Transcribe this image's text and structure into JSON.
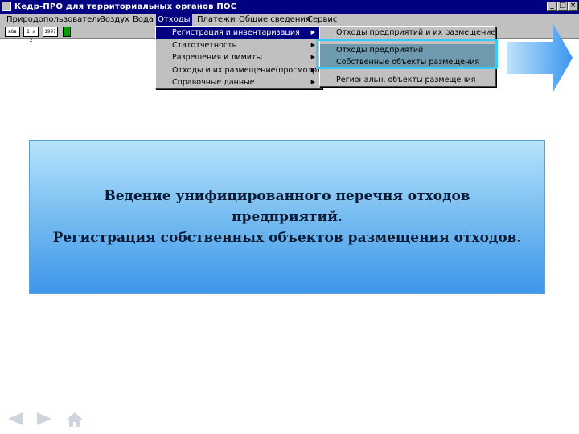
{
  "window": {
    "title": "Кедр-ПРО для территориальных органов ПОС",
    "buttons": [
      "_",
      "□",
      "×"
    ]
  },
  "menubar": {
    "items": [
      {
        "label": "Природопользователи",
        "active": false
      },
      {
        "label": "Воздух",
        "active": false
      },
      {
        "label": "Вода",
        "active": false
      },
      {
        "label": "Отходы",
        "active": true
      },
      {
        "label": "Платежи",
        "active": false
      },
      {
        "label": "Общие сведения",
        "active": false
      },
      {
        "label": "Сервис",
        "active": false
      }
    ]
  },
  "toolbar": {
    "buttons": [
      "абв",
      "1 x 2",
      "1997"
    ]
  },
  "menu_waste": {
    "items": [
      {
        "label": "Регистрация и инвентаризация",
        "submenu": true,
        "highlighted": true
      },
      {
        "label": "Статотчетность",
        "submenu": true
      },
      {
        "label": "Разрешения и лимиты",
        "submenu": true
      },
      {
        "label": "Отходы и их размещение(просмотр)",
        "submenu": true
      },
      {
        "label": "Справочные данные",
        "submenu": true
      }
    ]
  },
  "submenu_registration": {
    "items": [
      {
        "label": "Отходы предприятий и их размещение",
        "highlighted": false
      },
      {
        "label": "Отходы предприятий",
        "highlighted": true
      },
      {
        "label": "Собственные объекты размещения",
        "highlighted": true
      },
      {
        "label": "Региональн. объекты размещения",
        "highlighted": false
      }
    ]
  },
  "info_panel": {
    "lines": [
      "Ведение унифицированного перечня отходов",
      "предприятий.",
      "Регистрация собственных объектов размещения отходов."
    ]
  },
  "colors": {
    "titlebar": "#000080",
    "panel_top": "#b6e3fb",
    "panel_bottom": "#3f96ec",
    "highlight_outline": "#33ccff",
    "arrow": "#4aa3f0"
  },
  "nav": {
    "icons": [
      "arrow-left-icon",
      "arrow-right-icon",
      "home-icon"
    ]
  }
}
